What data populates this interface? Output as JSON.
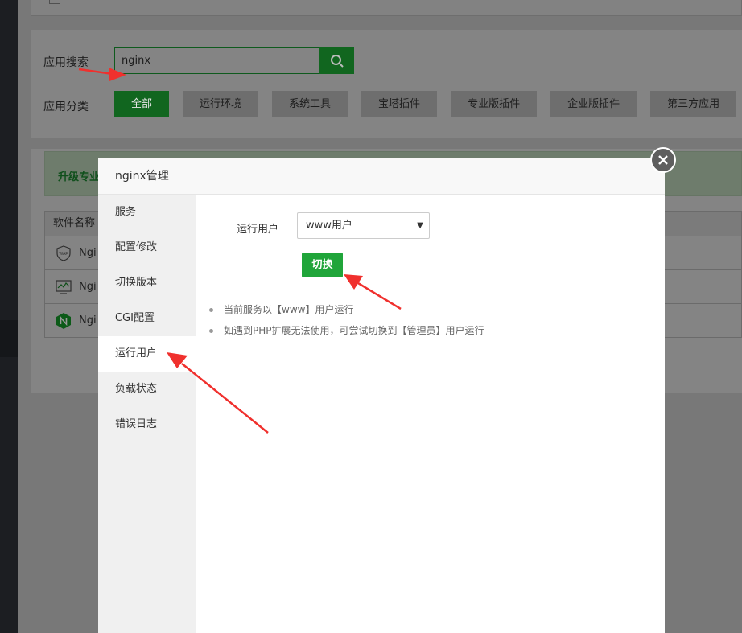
{
  "search": {
    "label": "应用搜索",
    "value": "nginx"
  },
  "categories": {
    "label": "应用分类",
    "items": [
      "全部",
      "运行环境",
      "系统工具",
      "宝塔插件",
      "专业版插件",
      "企业版插件",
      "第三方应用"
    ],
    "active": "全部"
  },
  "upgrade_banner": {
    "text": "升级专业"
  },
  "table": {
    "header": "软件名称",
    "rows": [
      {
        "name": "Ngi",
        "icon": "waf-icon"
      },
      {
        "name": "Ngi",
        "icon": "monitor-icon"
      },
      {
        "name": "Ngi",
        "icon": "nginx-icon"
      }
    ]
  },
  "modal": {
    "title": "nginx管理",
    "nav": [
      "服务",
      "配置修改",
      "切换版本",
      "CGI配置",
      "运行用户",
      "负载状态",
      "错误日志"
    ],
    "active_nav": "运行用户",
    "run_user_label": "运行用户",
    "run_user_selected": "www用户",
    "switch_label": "切换",
    "tips": [
      "当前服务以【www】用户运行",
      "如遇到PHP扩展无法使用，可尝试切换到【管理员】用户运行"
    ]
  },
  "colors": {
    "primary_green": "#20a53a",
    "annotation_red": "#f0302d"
  }
}
